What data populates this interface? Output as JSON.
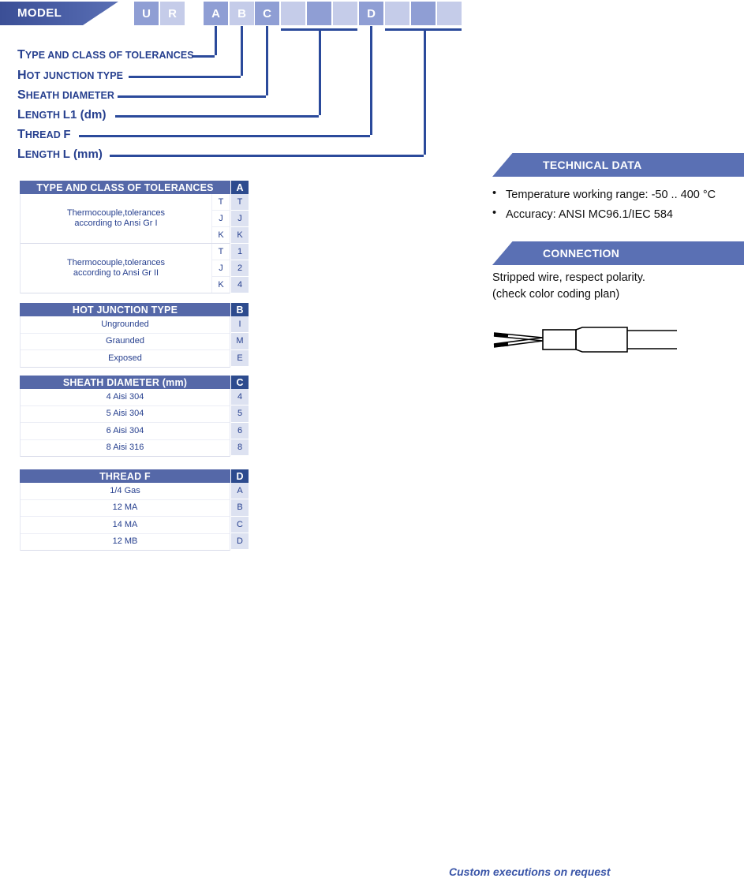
{
  "model": {
    "banner_label": "MODEL",
    "boxes": [
      {
        "label": "U",
        "shade": "dark"
      },
      {
        "label": "R",
        "shade": "light"
      },
      {
        "label": "A",
        "shade": "dark"
      },
      {
        "label": "B",
        "shade": "light"
      },
      {
        "label": "C",
        "shade": "dark"
      },
      {
        "label": "",
        "shade": "light"
      },
      {
        "label": "",
        "shade": "dark"
      },
      {
        "label": "",
        "shade": "light"
      },
      {
        "label": "D",
        "shade": "dark"
      },
      {
        "label": "",
        "shade": "light"
      },
      {
        "label": "",
        "shade": "dark"
      },
      {
        "label": "",
        "shade": "light"
      }
    ]
  },
  "callouts": [
    {
      "cap": "T",
      "rest": "YPE AND CLASS OF TOLERANCES"
    },
    {
      "cap": "H",
      "rest": "OT JUNCTION TYPE"
    },
    {
      "cap": "S",
      "rest": "HEATH DIAMETER"
    },
    {
      "cap": "L",
      "rest": "ENGTH ",
      "plain": "L1 (dm)"
    },
    {
      "cap": "T",
      "rest": "HREAD ",
      "plain": "F"
    },
    {
      "cap": "L",
      "rest": "ENGTH ",
      "plain": "L (mm)"
    }
  ],
  "tables": [
    {
      "header": "TYPE AND CLASS OF TOLERANCES",
      "code_header": "A",
      "type": "grouped",
      "groups": [
        {
          "label": "Thermocouple,tolerances\naccording to Ansi Gr I",
          "subs": [
            "T",
            "J",
            "K"
          ],
          "codes": [
            "T",
            "J",
            "K"
          ]
        },
        {
          "label": "Thermocouple,tolerances\naccording to Ansi Gr II",
          "subs": [
            "T",
            "J",
            "K"
          ],
          "codes": [
            "1",
            "2",
            "4"
          ]
        }
      ]
    },
    {
      "header": "HOT JUNCTION TYPE",
      "code_header": "B",
      "type": "simple",
      "rows": [
        {
          "label": "Ungrounded",
          "code": "I"
        },
        {
          "label": "Graunded",
          "code": "M"
        },
        {
          "label": "Exposed",
          "code": "E"
        }
      ]
    },
    {
      "header": "SHEATH DIAMETER (mm)",
      "code_header": "C",
      "type": "simple",
      "rows": [
        {
          "label": "4 Aisi 304",
          "code": "4"
        },
        {
          "label": "5 Aisi 304",
          "code": "5"
        },
        {
          "label": "6 Aisi 304",
          "code": "6"
        },
        {
          "label": "8 Aisi 316",
          "code": "8"
        }
      ]
    },
    {
      "header": "THREAD F",
      "code_header": "D",
      "type": "simple",
      "rows": [
        {
          "label": "1/4 Gas",
          "code": "A"
        },
        {
          "label": "12 MA",
          "code": "B"
        },
        {
          "label": "14 MA",
          "code": "C"
        },
        {
          "label": "12 MB",
          "code": "D"
        }
      ]
    }
  ],
  "technical_data": {
    "banner_label": "TECHNICAL DATA",
    "bullet_glyph": "•",
    "items": [
      "Temperature working range: -50 .. 400 °C",
      "Accuracy: ANSI MC96.1/IEC 584"
    ]
  },
  "connection": {
    "banner_label": "CONNECTION",
    "lines": [
      "Stripped wire, respect polarity.",
      "(check color coding plan)"
    ],
    "diagram_name": "stripped-wire-probe-diagram"
  },
  "footer": {
    "note": "Custom executions on request"
  },
  "colors": {
    "banner_navy": "#3b4f96",
    "banner_slate": "#5a70b4",
    "box_dark": "#8f9ed4",
    "box_light": "#c5cce9",
    "table_header": "#5568a8",
    "code_header": "#2d4b8e",
    "code_cell": "#dde2f1",
    "text_blue": "#27408f",
    "line_blue": "#2b4a9b"
  }
}
